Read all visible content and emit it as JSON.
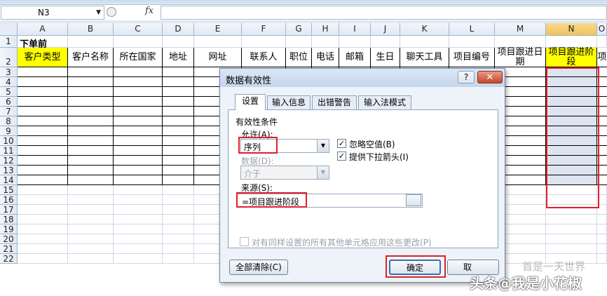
{
  "formula_bar": {
    "name_box": "N3",
    "fx": "fx",
    "formula": ""
  },
  "columns": [
    "A",
    "B",
    "C",
    "D",
    "E",
    "F",
    "G",
    "H",
    "I",
    "J",
    "K",
    "L",
    "M",
    "N",
    "O"
  ],
  "rows": [
    "1",
    "2",
    "3",
    "4",
    "5",
    "6",
    "7",
    "8",
    "9",
    "10",
    "11",
    "12",
    "13",
    "14",
    "15",
    "16",
    "17",
    "18",
    "19",
    "20",
    "21",
    "22"
  ],
  "sheet": {
    "title": "下单前",
    "headers": [
      "客户类型",
      "客户名称",
      "所在国家",
      "地址",
      "网址",
      "联系人",
      "职位",
      "电话",
      "邮箱",
      "生日",
      "聊天工具",
      "项目编号",
      "项目跟进日期",
      "项目跟进阶段",
      "项"
    ]
  },
  "dialog": {
    "title": "数据有效性",
    "help": "?",
    "close": "✕",
    "tabs": [
      "设置",
      "输入信息",
      "出错警告",
      "输入法模式"
    ],
    "criteria_label": "有效性条件",
    "allow_label": "允许(A):",
    "allow_value": "序列",
    "data_label": "数据(D):",
    "data_value": "介于",
    "ignore_blank": "忽略空值(B)",
    "dropdown": "提供下拉箭头(I)",
    "source_label": "来源(S):",
    "source_value": "=项目跟进阶段",
    "apply_all": "对有同样设置的所有其他单元格应用这些更改(P)",
    "clear_all": "全部清除(C)",
    "ok": "确定",
    "cancel": "取"
  },
  "watermark": {
    "main": "头条@我是小花椒",
    "sub": "首是一天世界"
  },
  "colors": {
    "accent_red": "#e0202a",
    "header_yellow": "#ffff00",
    "selected_col": "#f2c25a"
  }
}
